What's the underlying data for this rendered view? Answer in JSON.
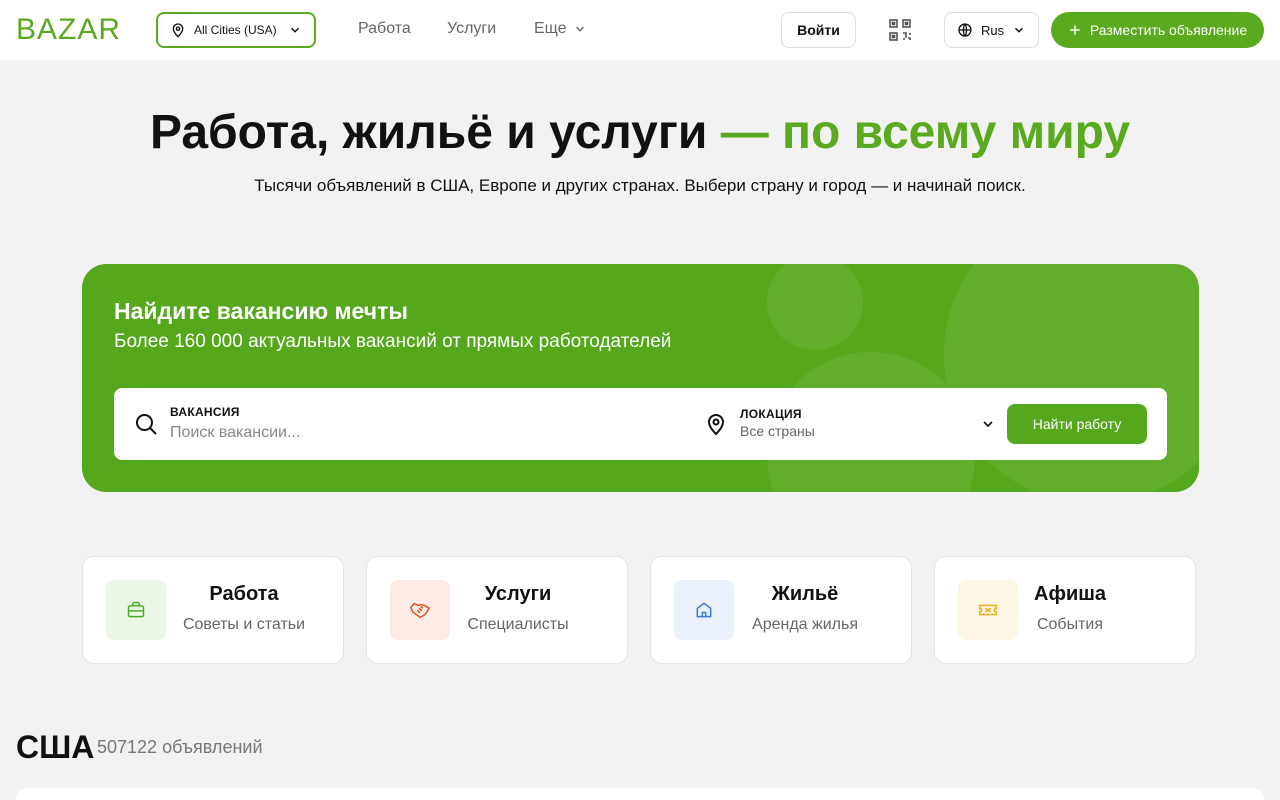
{
  "header": {
    "logo": "BAZAR",
    "city": "All Cities (USA)",
    "nav": [
      "Работа",
      "Услуги",
      "Еще"
    ],
    "login": "Войти",
    "lang": "Rus",
    "post_ad": "Разместить объявление"
  },
  "hero": {
    "title_main": "Работа, жильё и услуги",
    "title_accent": "— по всему миру",
    "subtitle": "Тысячи объявлений в США, Европе и других странах. Выбери страну и город — и начинай поиск."
  },
  "banner": {
    "title": "Найдите вакансию мечты",
    "subtitle": "Более 160 000 актуальных вакансий от прямых работодателей",
    "job_label": "ВАКАНСИЯ",
    "job_placeholder": "Поиск вакансии...",
    "loc_label": "ЛОКАЦИЯ",
    "loc_value": "Все страны",
    "find_button": "Найти работу"
  },
  "categories": [
    {
      "title": "Работа",
      "subtitle": "Советы и статьи",
      "icon": "briefcase-icon",
      "color": "#4caf2a",
      "bg": "#ecf6e7"
    },
    {
      "title": "Услуги",
      "subtitle": "Специалисты",
      "icon": "handshake-icon",
      "color": "#e0562b",
      "bg": "#fdece6"
    },
    {
      "title": "Жильё",
      "subtitle": "Аренда жилья",
      "icon": "house-icon",
      "color": "#3a78d4",
      "bg": "#eaf1fc"
    },
    {
      "title": "Афиша",
      "subtitle": "События",
      "icon": "ticket-icon",
      "color": "#e8b02a",
      "bg": "#fdf6e4"
    }
  ],
  "section": {
    "title": "США",
    "count": "507122 объявлений"
  },
  "colors": {
    "accent": "#5aaa1f",
    "banner": "#55a81c"
  }
}
